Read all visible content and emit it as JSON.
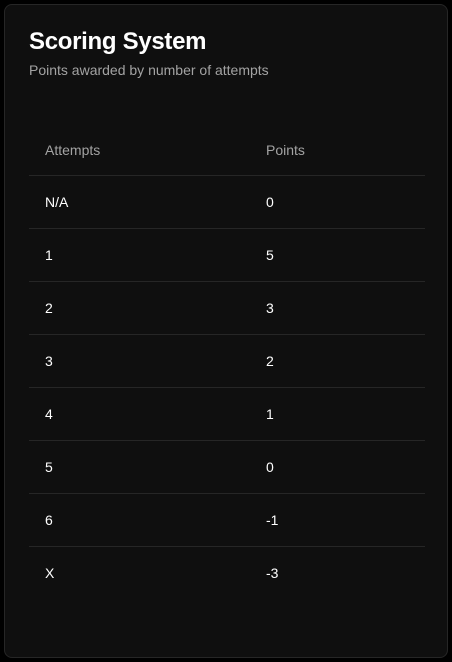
{
  "card": {
    "title": "Scoring System",
    "subtitle": "Points awarded by number of attempts"
  },
  "table": {
    "headers": {
      "attempts": "Attempts",
      "points": "Points"
    },
    "rows": [
      {
        "attempts": "N/A",
        "points": "0"
      },
      {
        "attempts": "1",
        "points": "5"
      },
      {
        "attempts": "2",
        "points": "3"
      },
      {
        "attempts": "3",
        "points": "2"
      },
      {
        "attempts": "4",
        "points": "1"
      },
      {
        "attempts": "5",
        "points": "0"
      },
      {
        "attempts": "6",
        "points": "-1"
      },
      {
        "attempts": "X",
        "points": "-3"
      }
    ]
  },
  "colors": {
    "background": "#000000",
    "card": "#0f0f0f",
    "border": "#262626",
    "muted_text": "#a3a3a3",
    "text": "#ffffff"
  }
}
